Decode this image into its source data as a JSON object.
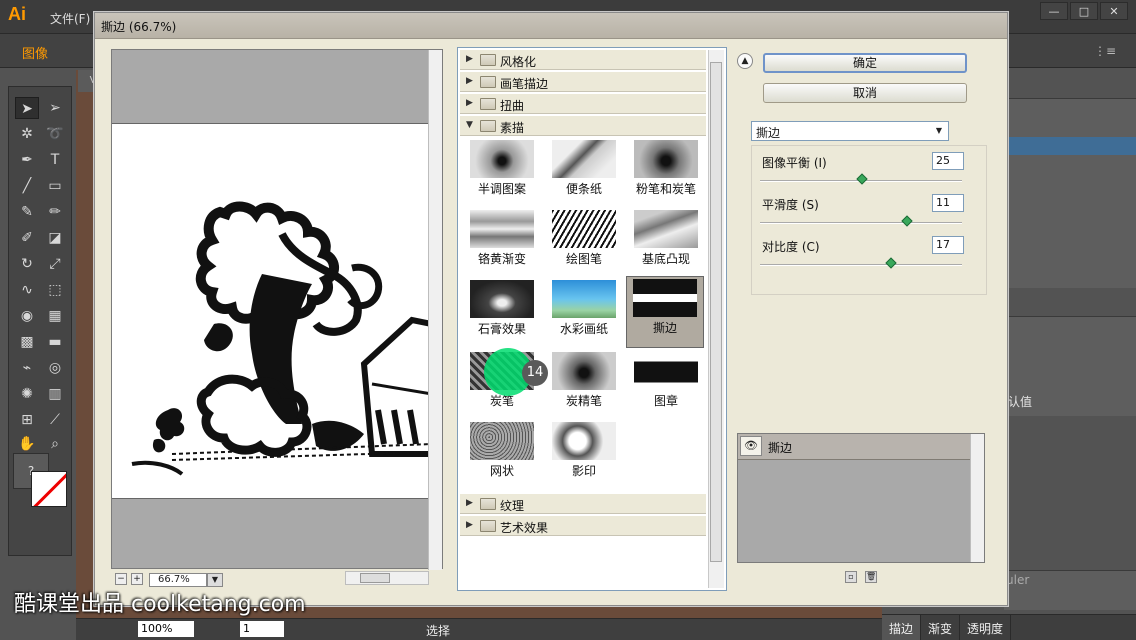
{
  "app": {
    "logo": "Ai",
    "menu_file": "文件(F)",
    "control_label": "图像",
    "window_buttons": [
      "—",
      "□",
      "✕"
    ]
  },
  "dialog": {
    "title": "撕边 (66.7%)",
    "ok_label": "确定",
    "cancel_label": "取消",
    "zoom_value": "66.7%",
    "categories_top": [
      "风格化",
      "画笔描边",
      "扭曲",
      "素描"
    ],
    "categories_bottom": [
      "纹理",
      "艺术效果"
    ],
    "filters": [
      {
        "label": "半调图案"
      },
      {
        "label": "便条纸"
      },
      {
        "label": "粉笔和炭笔"
      },
      {
        "label": "铬黄渐变"
      },
      {
        "label": "绘图笔"
      },
      {
        "label": "基底凸现"
      },
      {
        "label": "石膏效果"
      },
      {
        "label": "水彩画纸"
      },
      {
        "label": "撕边"
      },
      {
        "label": "炭笔"
      },
      {
        "label": "炭精笔"
      },
      {
        "label": "图章"
      },
      {
        "label": "网状"
      },
      {
        "label": "影印"
      }
    ],
    "selected_filter": "撕边",
    "params": [
      {
        "label": "图像平衡 (I)",
        "value": "25",
        "fraction": 0.5
      },
      {
        "label": "平滑度 (S)",
        "value": "11",
        "fraction": 0.73
      },
      {
        "label": "对比度 (C)",
        "value": "17",
        "fraction": 0.65
      }
    ],
    "layer_name": "撕边"
  },
  "cursor_step": "14",
  "status": {
    "zoom": "100%",
    "page": "1",
    "selection_label": "选择"
  },
  "right_panel": {
    "text_value": "认值",
    "ruler_label": "uler",
    "tabs": [
      "描边",
      "渐变",
      "透明度"
    ]
  },
  "watermark": "酷课堂出品 coolketang.com"
}
